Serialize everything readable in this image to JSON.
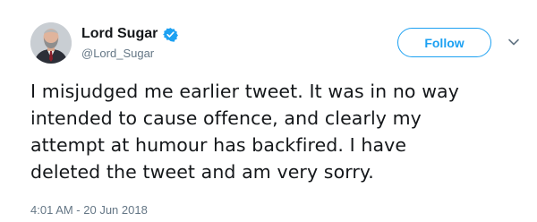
{
  "user": {
    "display_name": "Lord Sugar",
    "handle": "@Lord_Sugar",
    "verified": true
  },
  "follow_button": {
    "label": "Follow"
  },
  "tweet": {
    "lines": [
      "I misjudged me earlier tweet. It was in no way",
      "intended to cause offence, and clearly my",
      "attempt at humour has backfired. I have",
      "deleted the tweet and am very sorry."
    ],
    "timestamp": "4:01 AM - 20 Jun 2018"
  },
  "icons": {
    "avatar": "profile-photo",
    "verified": "verified-badge-icon",
    "menu": "chevron-down-icon"
  },
  "colors": {
    "brand": "#1da1f2",
    "text": "#14171a",
    "secondary_text": "#657786"
  }
}
